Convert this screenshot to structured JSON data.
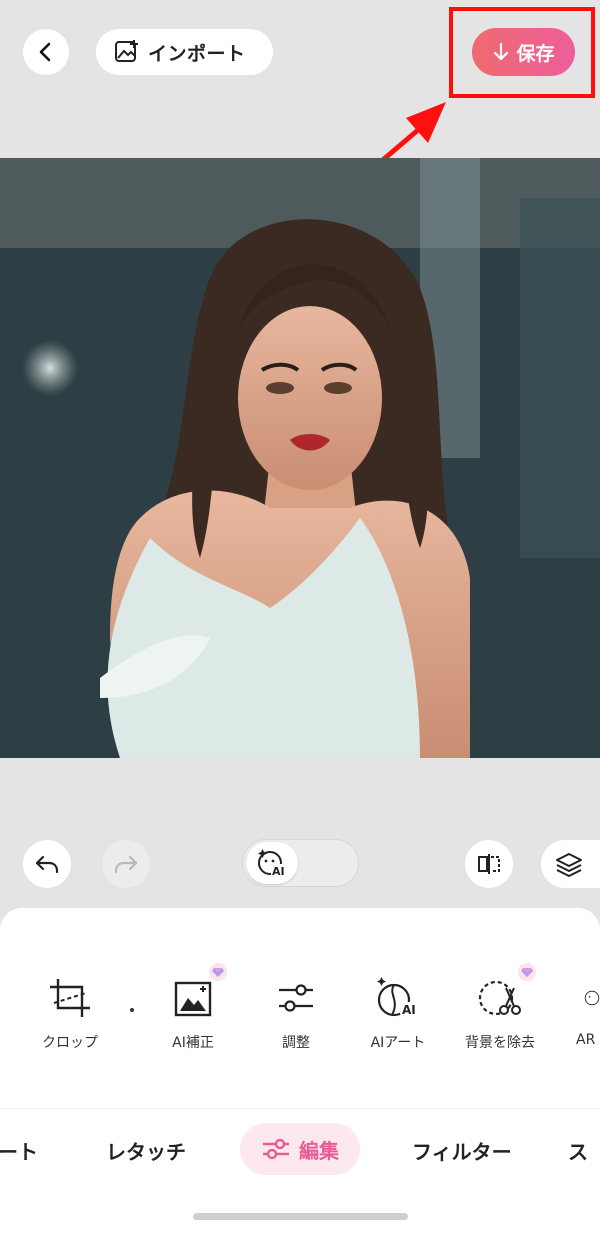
{
  "header": {
    "import_label": "インポート",
    "save_label": "保存"
  },
  "tools": [
    {
      "label": "クロップ",
      "icon": "crop-icon"
    },
    {
      "label": "AI補正",
      "icon": "ai-enhance-icon",
      "premium": true
    },
    {
      "label": "調整",
      "icon": "adjust-icon"
    },
    {
      "label": "AIアート",
      "icon": "ai-art-icon"
    },
    {
      "label": "背景を除去",
      "icon": "remove-background-icon",
      "premium": true
    },
    {
      "label": "AR",
      "icon": "ar-icon"
    }
  ],
  "tabs": {
    "partial_left": "ート",
    "retouch": "レタッチ",
    "edit": "編集",
    "filter": "フィルター",
    "partial_right": "ス"
  },
  "colors": {
    "accent": "#e85c94",
    "save_gradient_start": "#f06a6f",
    "save_gradient_end": "#ec5f9a",
    "highlight": "#ff0e0e"
  }
}
